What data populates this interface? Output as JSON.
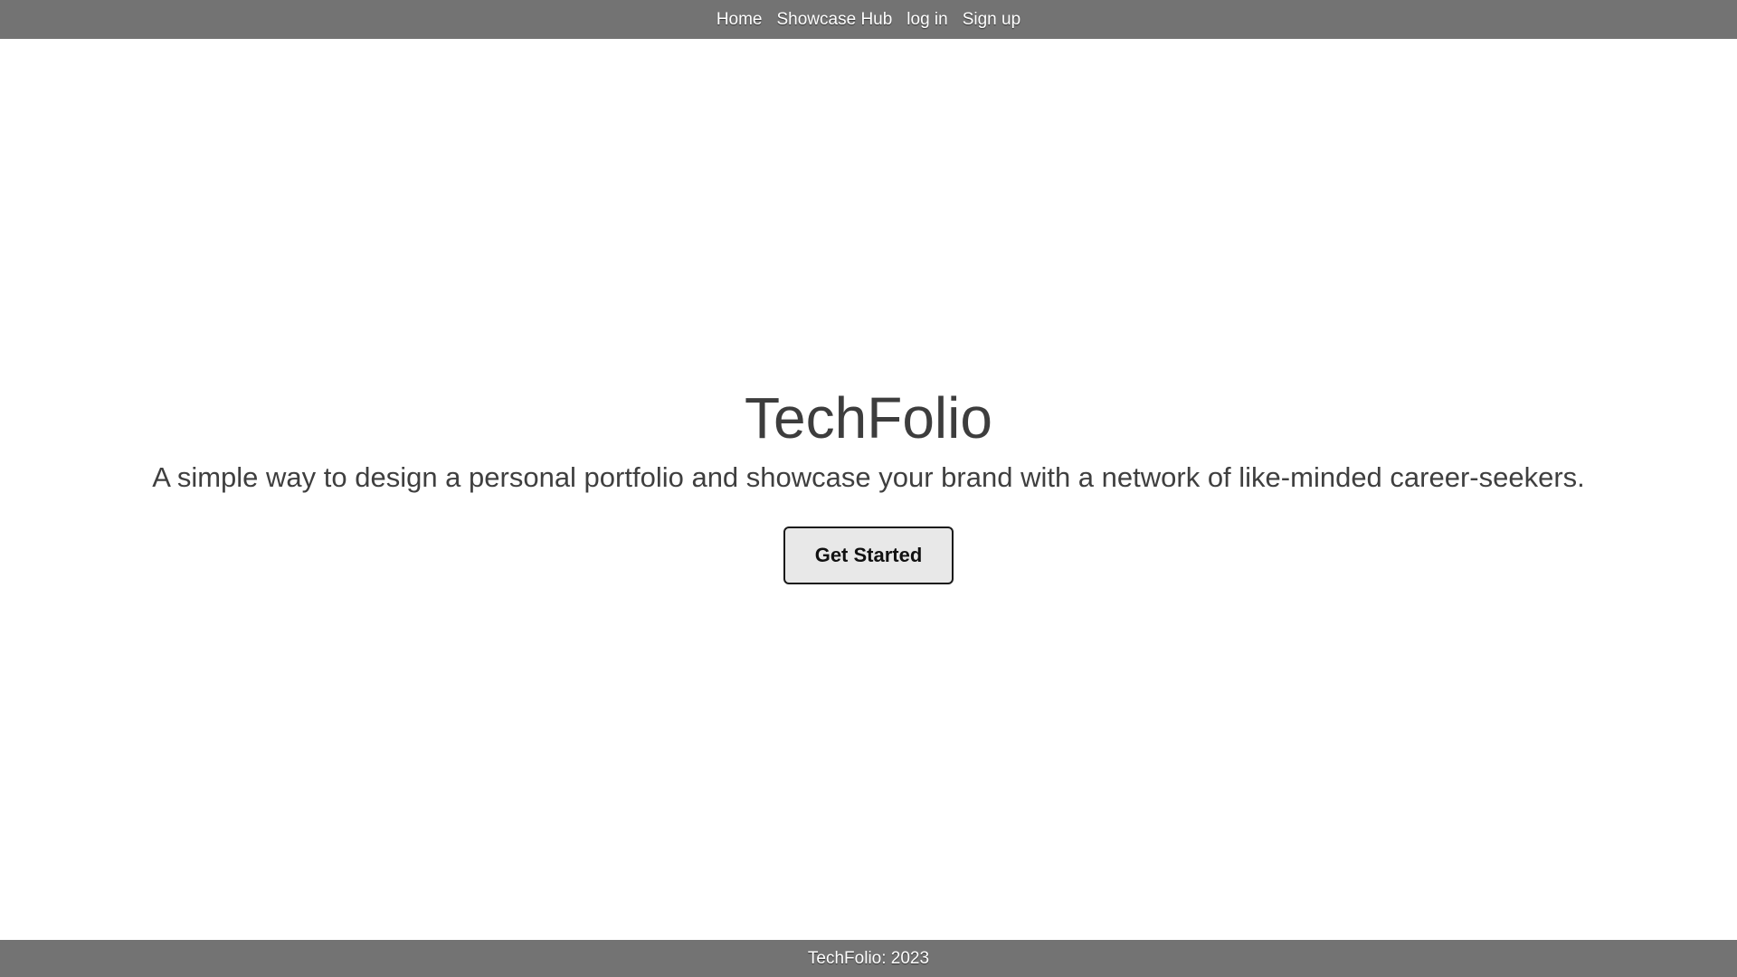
{
  "nav": {
    "items": [
      {
        "label": "Home"
      },
      {
        "label": "Showcase Hub"
      },
      {
        "label": "log in"
      },
      {
        "label": "Sign up"
      }
    ]
  },
  "hero": {
    "title": "TechFolio",
    "subtitle": "A simple way to design a personal portfolio and showcase your brand with a network of like-minded career-seekers.",
    "cta_label": "Get Started"
  },
  "footer": {
    "text": "TechFolio: 2023"
  },
  "colors": {
    "bar_background": "#737373",
    "text_dark": "#3d3d3d",
    "button_background": "#e8e8e8"
  }
}
